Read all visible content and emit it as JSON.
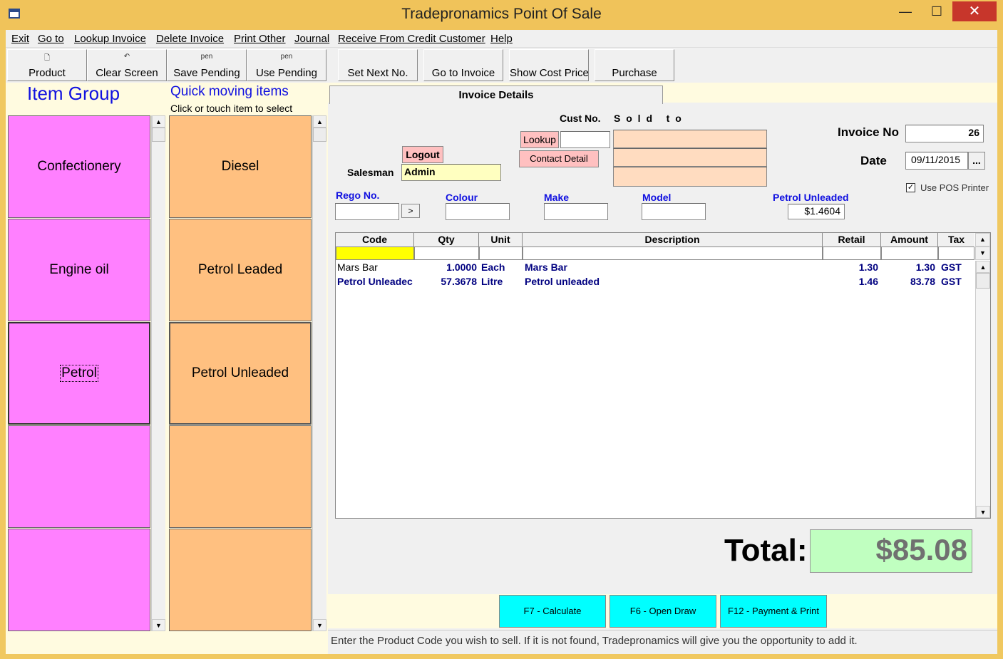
{
  "window": {
    "title": "Tradepronamics Point Of Sale",
    "minimize": "—",
    "maximize": "☐",
    "close": "✕"
  },
  "menu": [
    "Exit",
    "Go to",
    "Lookup Invoice",
    "Delete Invoice",
    "Print Other",
    "Journal",
    "Receive From Credit Customer",
    "Help"
  ],
  "toolbar": [
    {
      "label": "Product",
      "icon": "🗋"
    },
    {
      "label": "Clear Screen",
      "icon": "↶"
    },
    {
      "label": "Save Pending",
      "icon": "pen"
    },
    {
      "label": "Use Pending",
      "icon": "pen"
    },
    {
      "label": "Set Next No.",
      "icon": ""
    },
    {
      "label": "Go to Invoice",
      "icon": ""
    },
    {
      "label": "Show Cost Price",
      "icon": ""
    },
    {
      "label": "Purchase",
      "icon": ""
    }
  ],
  "left": {
    "item_group_title": "Item Group",
    "quick_title": "Quick moving items",
    "quick_sub": "Click or touch item to select",
    "groups": [
      "Confectionery",
      "Engine oil",
      "Petrol",
      "",
      ""
    ],
    "quick_items": [
      "Diesel",
      "Petrol Leaded",
      "Petrol Unleaded",
      "",
      ""
    ]
  },
  "invoice": {
    "tab_label": "Invoice Details",
    "cust_no_label": "Cust No.",
    "sold_to_label": "S o l d   t o",
    "lookup_btn": "Lookup",
    "contact_btn": "Contact Detail",
    "logout_btn": "Logout",
    "salesman_label": "Salesman",
    "salesman_value": "Admin",
    "invoice_no_label": "Invoice No",
    "invoice_no_value": "26",
    "date_label": "Date",
    "date_value": "09/11/2015",
    "date_btn": "...",
    "pos_printer_label": "Use POS Printer",
    "pos_printer_checked": "✓",
    "rego_label": "Rego No.",
    "rego_btn": ">",
    "colour_label": "Colour",
    "make_label": "Make",
    "model_label": "Model",
    "price_label": "Petrol Unleaded",
    "price_value": "$1.4604"
  },
  "grid": {
    "headers": [
      "Code",
      "Qty",
      "Unit",
      "Description",
      "Retail",
      "Amount",
      "Tax"
    ],
    "rows": [
      {
        "code": "Mars Bar",
        "qty": "1.0000",
        "unit": "Each",
        "desc": "Mars Bar",
        "retail": "1.30",
        "amount": "1.30",
        "tax": "GST"
      },
      {
        "code": "Petrol Unleadec",
        "qty": "57.3678",
        "unit": "Litre",
        "desc": "Petrol unleaded",
        "retail": "1.46",
        "amount": "83.78",
        "tax": "GST"
      }
    ]
  },
  "total": {
    "label": "Total:",
    "value": "$85.08"
  },
  "actions": [
    "F7 - Calculate",
    "F6 - Open Draw",
    "F12 - Payment & Print"
  ],
  "status": "Enter the Product Code you wish to sell. If it is not found, Tradepronamics will give you the opportunity to add it.",
  "colors": {
    "pink_tile": "#ff80ff",
    "orange_tile": "#ffc080",
    "total_bg": "#c0ffc0",
    "action_btn": "#00ffff",
    "title_bar": "#f0c35a"
  }
}
